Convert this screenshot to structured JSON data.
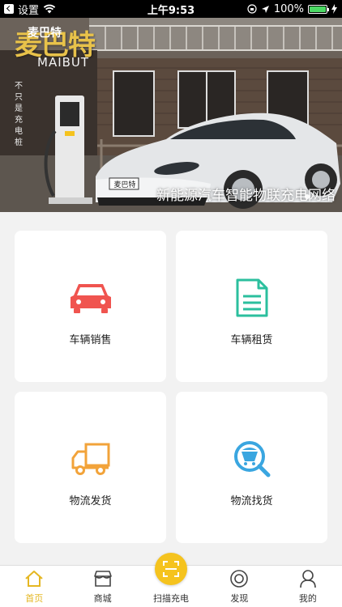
{
  "status_bar": {
    "back_label": "设置",
    "time": "上午9:53",
    "battery": "100%"
  },
  "banner": {
    "brand_cn": "麦巴特",
    "brand_overlay": "麦巴特",
    "brand_en": "MAIBUT",
    "slogan_chars": [
      "不",
      "只",
      "是",
      "充",
      "电",
      "桩"
    ],
    "caption": "新能源汽车智能物联充电网络",
    "plate": "麦巴特"
  },
  "cards": [
    {
      "label": "车辆销售",
      "icon": "car-icon",
      "color": "#f0544f"
    },
    {
      "label": "车辆租赁",
      "icon": "document-icon",
      "color": "#2bbf9e"
    },
    {
      "label": "物流发货",
      "icon": "truck-icon",
      "color": "#f2a33a"
    },
    {
      "label": "物流找货",
      "icon": "search-cart-icon",
      "color": "#3aa6e0"
    }
  ],
  "tabbar": {
    "home": "首页",
    "shop": "商城",
    "scan": "扫描充电",
    "discover": "发现",
    "mine": "我的",
    "accent": "#e5b722"
  }
}
